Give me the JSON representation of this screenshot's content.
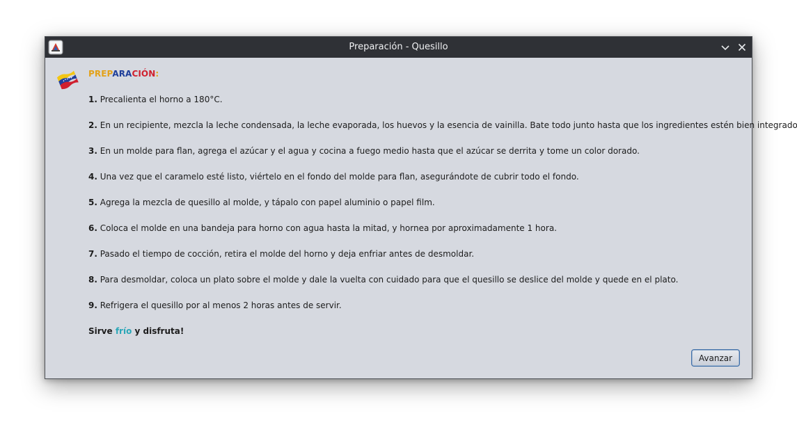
{
  "window": {
    "title": "Preparación - Quesillo"
  },
  "heading": {
    "part1": "PREP",
    "part2": "ARA",
    "part3": "CIÓN",
    "part4": ":"
  },
  "steps": [
    {
      "num": "1.",
      "text": " Precalienta el horno a 180°C."
    },
    {
      "num": "2.",
      "text": " En un recipiente, mezcla la leche condensada, la leche evaporada, los huevos y la esencia de vainilla. Bate todo junto hasta que los ingredientes estén bien integrados."
    },
    {
      "num": "3.",
      "text": " En un molde para flan, agrega el azúcar y el agua y cocina a fuego medio hasta que el azúcar se derrita y tome un color dorado."
    },
    {
      "num": "4.",
      "text": " Una vez que el caramelo esté listo, viértelo en el fondo del molde para flan, asegurándote de cubrir todo el fondo."
    },
    {
      "num": "5.",
      "text": " Agrega la mezcla de quesillo al molde, y tápalo con papel aluminio o papel film."
    },
    {
      "num": "6.",
      "text": " Coloca el molde en una bandeja para horno con agua hasta la mitad, y hornea por aproximadamente 1 hora."
    },
    {
      "num": "7.",
      "text": " Pasado el tiempo de cocción, retira el molde del horno y deja enfriar antes de desmoldar."
    },
    {
      "num": "8.",
      "text": " Para desmoldar, coloca un plato sobre el molde y dale la vuelta con cuidado para que el quesillo se deslice del molde y quede en el plato."
    },
    {
      "num": "9.",
      "text": " Refrigera el quesillo por al menos 2 horas antes de servir."
    }
  ],
  "closing": {
    "before": "Sirve ",
    "highlight": "frío",
    "after": " y disfruta!"
  },
  "buttons": {
    "advance": "Avanzar"
  },
  "icons": {
    "app": "java-app-icon",
    "flag": "venezuela-flag-icon",
    "minimize": "chevron-down-icon",
    "close": "close-icon"
  },
  "colors": {
    "titlebar": "#2f3136",
    "background": "#d6d9e0",
    "heading_yellow": "#e3a21a",
    "heading_blue": "#1f3f9a",
    "heading_red": "#d0202e",
    "highlight_cyan": "#2aa7b8"
  }
}
